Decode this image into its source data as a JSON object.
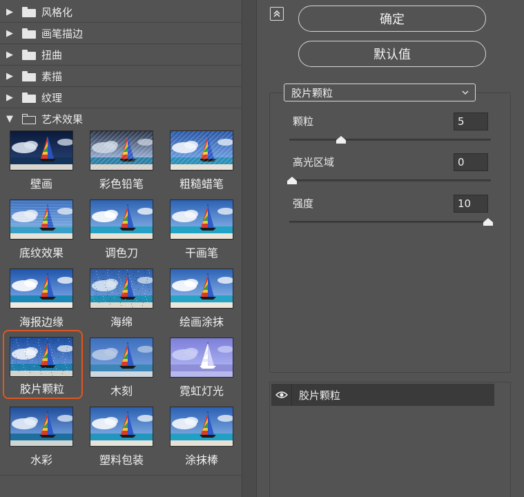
{
  "categories": [
    {
      "label": "风格化",
      "expanded": false
    },
    {
      "label": "画笔描边",
      "expanded": false
    },
    {
      "label": "扭曲",
      "expanded": false
    },
    {
      "label": "素描",
      "expanded": false
    },
    {
      "label": "纹理",
      "expanded": false
    },
    {
      "label": "艺术效果",
      "expanded": true
    }
  ],
  "filters": [
    {
      "label": "壁画",
      "style": "mural"
    },
    {
      "label": "彩色铅笔",
      "style": "pencil"
    },
    {
      "label": "粗糙蜡笔",
      "style": "pastel"
    },
    {
      "label": "底纹效果",
      "style": "underpaint"
    },
    {
      "label": "调色刀",
      "style": "palette"
    },
    {
      "label": "干画笔",
      "style": "drybrush"
    },
    {
      "label": "海报边缘",
      "style": "poster"
    },
    {
      "label": "海绵",
      "style": "sponge"
    },
    {
      "label": "绘画涂抹",
      "style": "smudge"
    },
    {
      "label": "胶片颗粒",
      "style": "grain",
      "selected": true
    },
    {
      "label": "木刻",
      "style": "cutout"
    },
    {
      "label": "霓虹灯光",
      "style": "neon"
    },
    {
      "label": "水彩",
      "style": "watercolor"
    },
    {
      "label": "塑料包装",
      "style": "plastic"
    },
    {
      "label": "涂抹棒",
      "style": "smudgestick"
    }
  ],
  "buttons": {
    "ok": "确定",
    "default": "默认值"
  },
  "dropdown": {
    "selected": "胶片颗粒"
  },
  "params": [
    {
      "label": "颗粒",
      "value": "5",
      "fraction": 0.25
    },
    {
      "label": "高光区域",
      "value": "0",
      "fraction": 0.0
    },
    {
      "label": "强度",
      "value": "10",
      "fraction": 1.0
    }
  ],
  "layer": {
    "name": "胶片颗粒"
  },
  "colors": {
    "selection": "#e2561f",
    "panel": "#535353"
  }
}
